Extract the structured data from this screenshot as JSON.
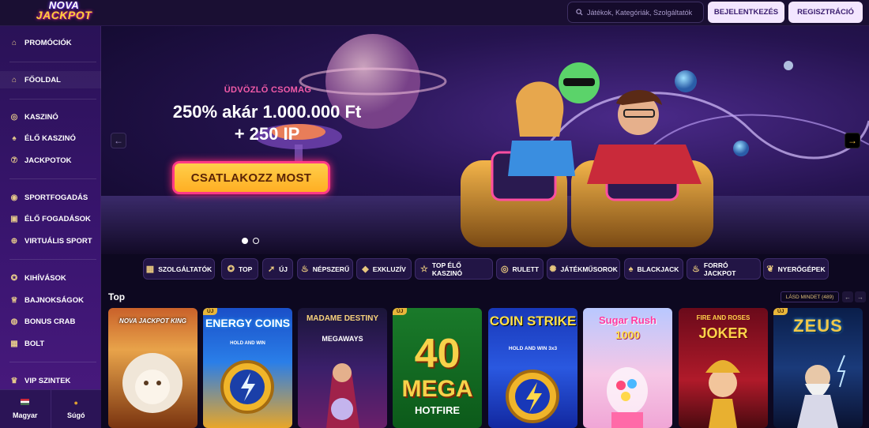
{
  "header": {
    "logo_line1": "NOVA",
    "logo_line2": "JACKPOT",
    "search_placeholder": "Játékok, Kategóriák, Szolgáltatók",
    "login_label": "BEJELENTKEZÉS",
    "register_label": "REGISZTRÁCIÓ"
  },
  "sidebar": {
    "items": [
      {
        "label": "PROMÓCIÓK",
        "icon": "gift-icon"
      },
      {
        "label": "FŐOLDAL",
        "icon": "home-icon"
      },
      {
        "label": "KASZINÓ",
        "icon": "chip-icon"
      },
      {
        "label": "ÉLŐ KASZINÓ",
        "icon": "spade-icon"
      },
      {
        "label": "JACKPOTOK",
        "icon": "seven-icon"
      },
      {
        "label": "SPORTFOGADÁS",
        "icon": "ball-icon"
      },
      {
        "label": "ÉLŐ FOGADÁSOK",
        "icon": "live-icon"
      },
      {
        "label": "VIRTUÁLIS SPORT",
        "icon": "gamepad-icon"
      },
      {
        "label": "KIHÍVÁSOK",
        "icon": "medal-icon"
      },
      {
        "label": "BAJNOKSÁGOK",
        "icon": "trophy-icon"
      },
      {
        "label": "BONUS CRAB",
        "icon": "crab-icon"
      },
      {
        "label": "BOLT",
        "icon": "shop-icon"
      },
      {
        "label": "VIP SZINTEK",
        "icon": "crown-icon"
      }
    ],
    "language_label": "Magyar",
    "help_label": "Súgó"
  },
  "hero": {
    "subtitle": "ÜDVÖZLŐ CSOMAG",
    "title_line1": "250% akár 1.000.000 Ft",
    "title_line2": "+ 250 IP",
    "cta_label": "CSATLAKOZZ MOST",
    "slide_count": 2,
    "active_slide": 1
  },
  "categories": [
    {
      "label": "SZOLGÁLTATÓK",
      "icon": "grid-icon"
    },
    {
      "label": "TOP",
      "icon": "medal-icon"
    },
    {
      "label": "ÚJ",
      "icon": "rocket-icon"
    },
    {
      "label": "NÉPSZERŰ",
      "icon": "flame-icon"
    },
    {
      "label": "EXKLUZÍV",
      "icon": "diamond-icon"
    },
    {
      "label": "TOP ÉLŐ KASZINÓ",
      "icon": "star-icon"
    },
    {
      "label": "RULETT",
      "icon": "roulette-icon"
    },
    {
      "label": "JÁTÉKMŰSOROK",
      "icon": "wheel-icon"
    },
    {
      "label": "BLACKJACK",
      "icon": "spade-icon"
    },
    {
      "label": "FORRÓ JACKPOT",
      "icon": "hot-icon"
    },
    {
      "label": "NYERŐGÉPEK",
      "icon": "cherry-icon"
    }
  ],
  "top_section": {
    "title": "Top",
    "see_all_label": "LÁSD MINDET (489)"
  },
  "new_badge": "ÚJ",
  "games": [
    {
      "title": "NOVA JACKPOT KING",
      "new": false
    },
    {
      "title": "ENERGY COINS",
      "subtitle": "HOLD AND WIN",
      "new": true
    },
    {
      "title": "MADAME DESTINY",
      "subtitle": "MEGAWAYS",
      "new": false
    },
    {
      "title": "40",
      "subtitle": "MEGA",
      "extra": "HOTFIRE",
      "new": true
    },
    {
      "title": "COIN STRIKE",
      "subtitle": "HOLD AND WIN 3x3",
      "new": false
    },
    {
      "title": "Sugar Rush",
      "subtitle": "1000",
      "new": false
    },
    {
      "title": "FIRE AND ROSES",
      "subtitle": "JOKER",
      "new": false
    },
    {
      "title": "ZEUS",
      "new": true
    }
  ]
}
